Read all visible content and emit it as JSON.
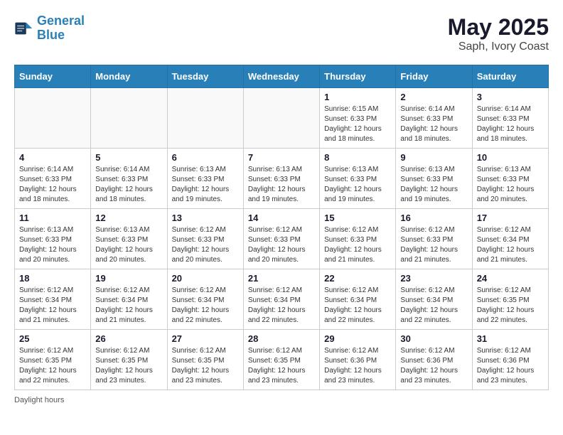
{
  "header": {
    "logo_line1": "General",
    "logo_line2": "Blue",
    "month_year": "May 2025",
    "location": "Saph, Ivory Coast"
  },
  "weekdays": [
    "Sunday",
    "Monday",
    "Tuesday",
    "Wednesday",
    "Thursday",
    "Friday",
    "Saturday"
  ],
  "weeks": [
    [
      {
        "day": "",
        "info": ""
      },
      {
        "day": "",
        "info": ""
      },
      {
        "day": "",
        "info": ""
      },
      {
        "day": "",
        "info": ""
      },
      {
        "day": "1",
        "info": "Sunrise: 6:15 AM\nSunset: 6:33 PM\nDaylight: 12 hours\nand 18 minutes."
      },
      {
        "day": "2",
        "info": "Sunrise: 6:14 AM\nSunset: 6:33 PM\nDaylight: 12 hours\nand 18 minutes."
      },
      {
        "day": "3",
        "info": "Sunrise: 6:14 AM\nSunset: 6:33 PM\nDaylight: 12 hours\nand 18 minutes."
      }
    ],
    [
      {
        "day": "4",
        "info": "Sunrise: 6:14 AM\nSunset: 6:33 PM\nDaylight: 12 hours\nand 18 minutes."
      },
      {
        "day": "5",
        "info": "Sunrise: 6:14 AM\nSunset: 6:33 PM\nDaylight: 12 hours\nand 18 minutes."
      },
      {
        "day": "6",
        "info": "Sunrise: 6:13 AM\nSunset: 6:33 PM\nDaylight: 12 hours\nand 19 minutes."
      },
      {
        "day": "7",
        "info": "Sunrise: 6:13 AM\nSunset: 6:33 PM\nDaylight: 12 hours\nand 19 minutes."
      },
      {
        "day": "8",
        "info": "Sunrise: 6:13 AM\nSunset: 6:33 PM\nDaylight: 12 hours\nand 19 minutes."
      },
      {
        "day": "9",
        "info": "Sunrise: 6:13 AM\nSunset: 6:33 PM\nDaylight: 12 hours\nand 19 minutes."
      },
      {
        "day": "10",
        "info": "Sunrise: 6:13 AM\nSunset: 6:33 PM\nDaylight: 12 hours\nand 20 minutes."
      }
    ],
    [
      {
        "day": "11",
        "info": "Sunrise: 6:13 AM\nSunset: 6:33 PM\nDaylight: 12 hours\nand 20 minutes."
      },
      {
        "day": "12",
        "info": "Sunrise: 6:13 AM\nSunset: 6:33 PM\nDaylight: 12 hours\nand 20 minutes."
      },
      {
        "day": "13",
        "info": "Sunrise: 6:12 AM\nSunset: 6:33 PM\nDaylight: 12 hours\nand 20 minutes."
      },
      {
        "day": "14",
        "info": "Sunrise: 6:12 AM\nSunset: 6:33 PM\nDaylight: 12 hours\nand 20 minutes."
      },
      {
        "day": "15",
        "info": "Sunrise: 6:12 AM\nSunset: 6:33 PM\nDaylight: 12 hours\nand 21 minutes."
      },
      {
        "day": "16",
        "info": "Sunrise: 6:12 AM\nSunset: 6:33 PM\nDaylight: 12 hours\nand 21 minutes."
      },
      {
        "day": "17",
        "info": "Sunrise: 6:12 AM\nSunset: 6:34 PM\nDaylight: 12 hours\nand 21 minutes."
      }
    ],
    [
      {
        "day": "18",
        "info": "Sunrise: 6:12 AM\nSunset: 6:34 PM\nDaylight: 12 hours\nand 21 minutes."
      },
      {
        "day": "19",
        "info": "Sunrise: 6:12 AM\nSunset: 6:34 PM\nDaylight: 12 hours\nand 21 minutes."
      },
      {
        "day": "20",
        "info": "Sunrise: 6:12 AM\nSunset: 6:34 PM\nDaylight: 12 hours\nand 22 minutes."
      },
      {
        "day": "21",
        "info": "Sunrise: 6:12 AM\nSunset: 6:34 PM\nDaylight: 12 hours\nand 22 minutes."
      },
      {
        "day": "22",
        "info": "Sunrise: 6:12 AM\nSunset: 6:34 PM\nDaylight: 12 hours\nand 22 minutes."
      },
      {
        "day": "23",
        "info": "Sunrise: 6:12 AM\nSunset: 6:34 PM\nDaylight: 12 hours\nand 22 minutes."
      },
      {
        "day": "24",
        "info": "Sunrise: 6:12 AM\nSunset: 6:35 PM\nDaylight: 12 hours\nand 22 minutes."
      }
    ],
    [
      {
        "day": "25",
        "info": "Sunrise: 6:12 AM\nSunset: 6:35 PM\nDaylight: 12 hours\nand 22 minutes."
      },
      {
        "day": "26",
        "info": "Sunrise: 6:12 AM\nSunset: 6:35 PM\nDaylight: 12 hours\nand 23 minutes."
      },
      {
        "day": "27",
        "info": "Sunrise: 6:12 AM\nSunset: 6:35 PM\nDaylight: 12 hours\nand 23 minutes."
      },
      {
        "day": "28",
        "info": "Sunrise: 6:12 AM\nSunset: 6:35 PM\nDaylight: 12 hours\nand 23 minutes."
      },
      {
        "day": "29",
        "info": "Sunrise: 6:12 AM\nSunset: 6:36 PM\nDaylight: 12 hours\nand 23 minutes."
      },
      {
        "day": "30",
        "info": "Sunrise: 6:12 AM\nSunset: 6:36 PM\nDaylight: 12 hours\nand 23 minutes."
      },
      {
        "day": "31",
        "info": "Sunrise: 6:12 AM\nSunset: 6:36 PM\nDaylight: 12 hours\nand 23 minutes."
      }
    ]
  ],
  "footer": {
    "text": "Daylight hours"
  }
}
